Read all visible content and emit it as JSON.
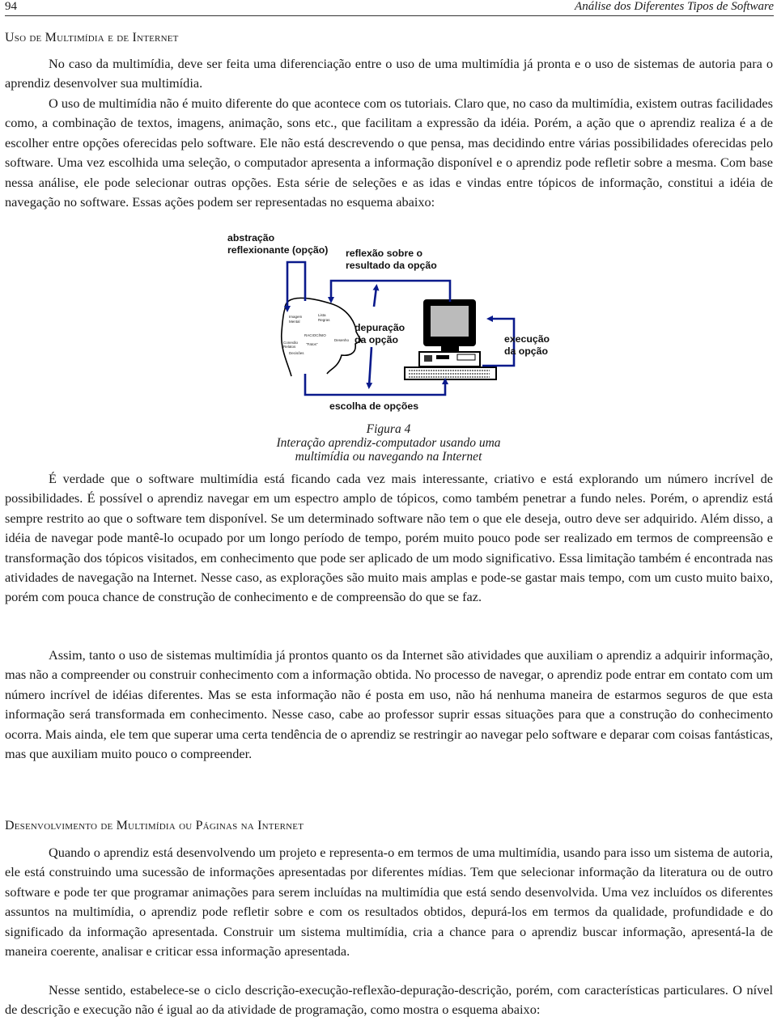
{
  "header": {
    "page_number": "94",
    "running_title": "Análise dos Diferentes Tipos de Software"
  },
  "section1": {
    "title": "Uso de Multimídia e de Internet",
    "paragraphs": [
      "No caso da multimídia, deve ser feita uma diferenciação entre o uso de uma multimídia já pronta e o uso de sistemas de autoria para o aprendiz desenvolver sua multimídia.",
      "O uso de multimídia não é muito diferente do que acontece com os tutoriais. Claro que, no caso da multimídia, existem outras facilidades como, a combinação de textos, imagens, animação, sons etc., que facilitam a expressão da idéia. Porém, a ação que o aprendiz realiza é a de escolher entre opções oferecidas pelo software. Ele não está descrevendo o que pensa, mas decidindo entre várias possibilidades oferecidas pelo software. Uma vez escolhida uma seleção, o computador apresenta a informação disponível e o aprendiz pode refletir sobre a mesma. Com base nessa análise, ele pode selecionar outras opções. Esta série de seleções e as idas e vindas entre tópicos de informação, constitui a idéia de navegação no software. Essas ações podem ser representadas no esquema abaixo:"
    ]
  },
  "figure": {
    "labels": {
      "abstraction": "abstração\nreflexionante (opção)",
      "reflection": "reflexão sobre o\nresultado da opção",
      "debugging": "depuração\nda opção",
      "execution": "execução\nda opção",
      "choice": "escolha de opções"
    },
    "arrow_color": "#0a1a8c",
    "caption": {
      "number": "Figura 4",
      "line1": "Interação aprendiz-computador usando uma",
      "line2": "multimídia ou navegando na Internet"
    }
  },
  "section1_cont": {
    "paragraphs": [
      "É verdade que o software multimídia está ficando cada vez mais interessante, criativo e está explorando um número incrível de possibilidades. É possível o aprendiz navegar em um espectro amplo de tópicos, como também penetrar a fundo neles. Porém, o aprendiz está sempre restrito ao que o software tem disponível. Se um determinado software não tem o que ele deseja, outro deve ser adquirido. Além disso, a idéia de navegar pode mantê-lo ocupado por um longo período de tempo, porém muito pouco pode ser realizado em termos de compreensão e transformação dos tópicos visitados, em conhecimento que pode ser aplicado de um modo significativo. Essa limitação também é encontrada nas atividades de navegação na Internet. Nesse caso, as explorações são muito mais amplas e pode-se gastar mais tempo, com um custo muito baixo, porém com pouca chance de construção de conhecimento e de compreensão do que se faz.",
      "Assim, tanto o uso de sistemas multimídia já prontos quanto os da Internet são atividades que auxiliam o aprendiz a adquirir informação, mas não a compreender ou construir conhecimento com a informação obtida. No processo de navegar, o aprendiz pode entrar em contato com um número incrível de idéias diferentes. Mas se esta informação não é posta em uso, não há nenhuma maneira de estarmos seguros de que esta informação será transformada em conhecimento. Nesse caso, cabe ao professor suprir essas situações para que a construção do conhecimento ocorra. Mais ainda, ele tem que superar uma certa tendência de o aprendiz se restringir ao navegar pelo software e deparar com coisas fantásticas, mas que auxiliam muito pouco o compreender."
    ]
  },
  "section2": {
    "title": "Desenvolvimento de Multimídia ou Páginas na Internet",
    "paragraphs": [
      "Quando o aprendiz está desenvolvendo um projeto e representa-o em termos de uma multimídia, usando para isso um sistema de autoria, ele está construindo uma sucessão de informações apresentadas por diferentes mídias. Tem que selecionar informação da literatura ou de outro software e pode ter que programar animações para serem incluídas na multimídia que está sendo desenvolvida. Uma vez incluídos os diferentes assuntos na multimídia, o aprendiz pode refletir sobre e com os resultados obtidos, depurá-los em termos da qualidade, profundidade e do significado da informação apresentada. Construir um sistema multimídia, cria a chance para o aprendiz buscar informação, apresentá-la de maneira coerente, analisar e criticar essa informação apresentada.",
      "Nesse sentido, estabelece-se o ciclo descrição-execução-reflexão-depuração-descrição, porém, com características particulares. O nível de descrição e execução não é igual ao da atividade de programação, como mostra o esquema abaixo:"
    ]
  }
}
